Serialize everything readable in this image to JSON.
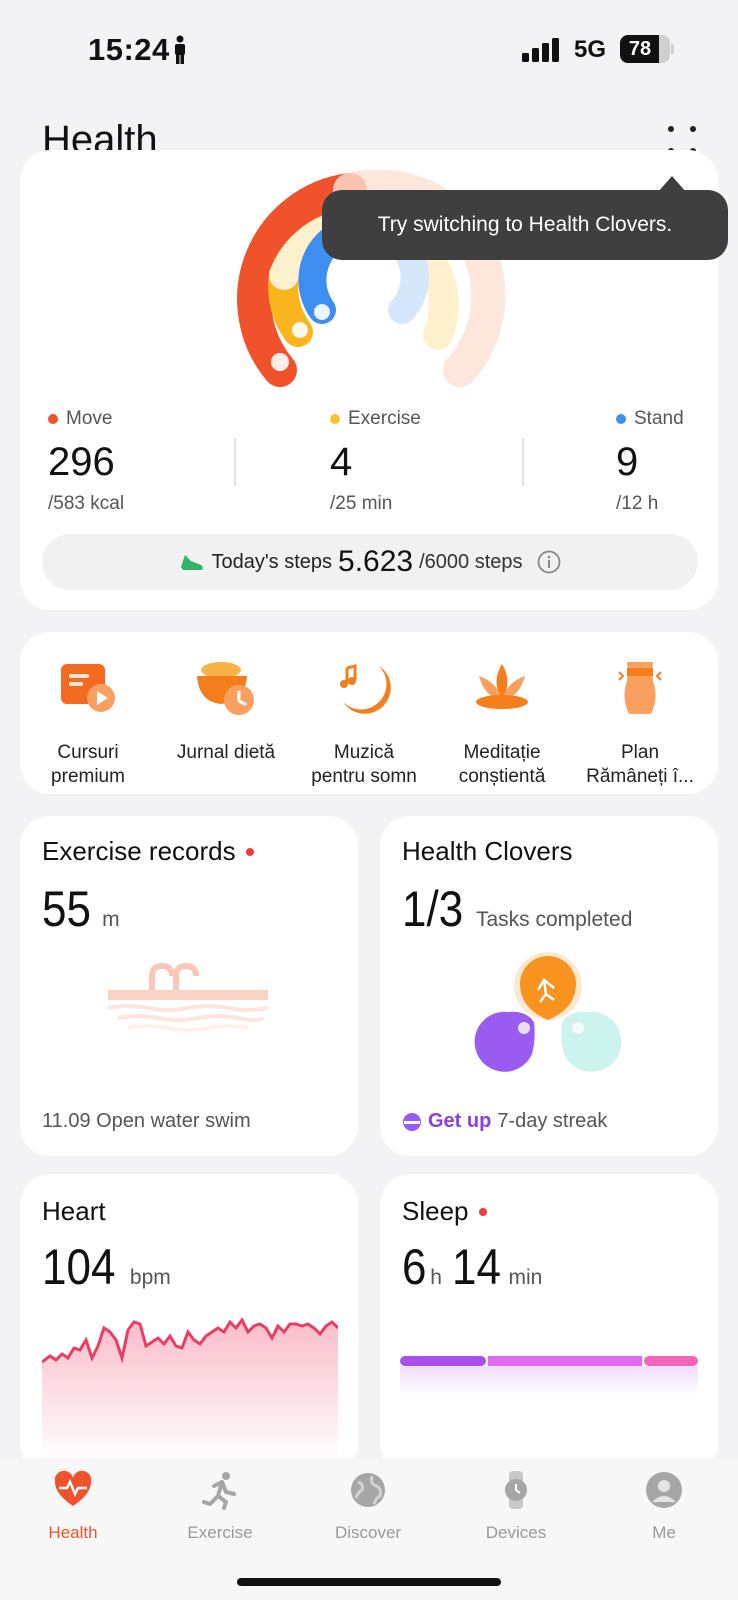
{
  "status": {
    "time": "15:24",
    "network": "5G",
    "battery": "78",
    "battery_level": 0.78
  },
  "header": {
    "title": "Health"
  },
  "tooltip": {
    "text": "Try switching to Health Clovers."
  },
  "activity": {
    "move": {
      "label": "Move",
      "value": "296",
      "goal": "/583 kcal",
      "color": "#f0522c"
    },
    "exercise": {
      "label": "Exercise",
      "value": "4",
      "goal": "/25 min",
      "color": "#f8c22e"
    },
    "stand": {
      "label": "Stand",
      "value": "9",
      "goal": "/12 h",
      "color": "#3d8ef0"
    }
  },
  "steps": {
    "label": "Today's steps",
    "value": "5.623",
    "goal": "/6000 steps"
  },
  "services": [
    {
      "label": "Cursuri\npremium",
      "icon": "video-course-icon"
    },
    {
      "label": "Jurnal dietă",
      "icon": "diet-bowl-icon"
    },
    {
      "label": "Muzică\npentru somn",
      "icon": "sleep-music-icon"
    },
    {
      "label": "Meditație\nconștientă",
      "icon": "lotus-icon"
    },
    {
      "label": "Plan\nRămâneți î...",
      "icon": "body-plan-icon"
    }
  ],
  "exercise_records": {
    "title": "Exercise records",
    "value": "55",
    "unit": "m",
    "footer": "11.09 Open water swim"
  },
  "clovers": {
    "title": "Health Clovers",
    "value": "1/3",
    "sub": "Tasks completed",
    "streak_label": "Get up",
    "streak_text": "7-day streak"
  },
  "heart": {
    "title": "Heart",
    "value": "104",
    "unit": "bpm"
  },
  "sleep": {
    "title": "Sleep",
    "hours": "6",
    "h_unit": "h",
    "minutes": "14",
    "m_unit": "min"
  },
  "tabs": [
    {
      "label": "Health",
      "icon": "heart-pulse-icon",
      "active": true
    },
    {
      "label": "Exercise",
      "icon": "running-icon",
      "active": false
    },
    {
      "label": "Discover",
      "icon": "globe-icon",
      "active": false
    },
    {
      "label": "Devices",
      "icon": "watch-icon",
      "active": false
    },
    {
      "label": "Me",
      "icon": "user-icon",
      "active": false
    }
  ]
}
